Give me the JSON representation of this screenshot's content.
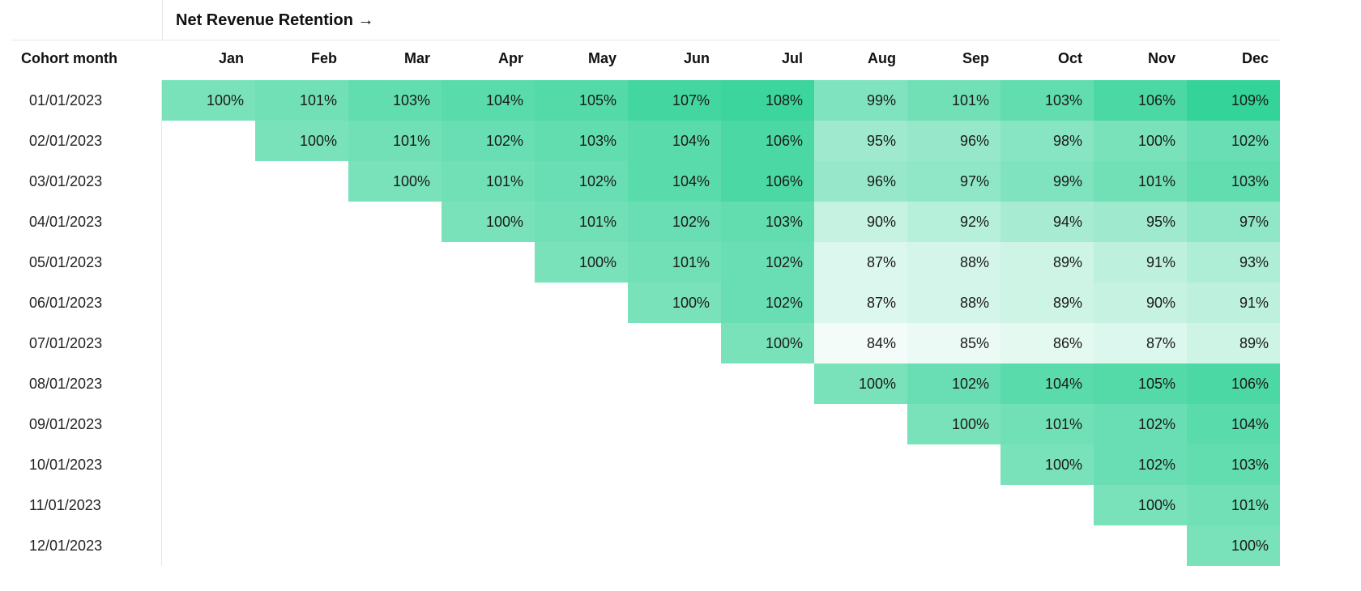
{
  "chart_data": {
    "type": "heatmap",
    "title": "Net Revenue Retention →",
    "row_header": "Cohort month",
    "columns": [
      "Jan",
      "Feb",
      "Mar",
      "Apr",
      "May",
      "Jun",
      "Jul",
      "Aug",
      "Sep",
      "Oct",
      "Nov",
      "Dec"
    ],
    "unit": "%",
    "color_scale": {
      "type": "linear",
      "domain_min": 84,
      "domain_max": 109,
      "range_min": "#f3fcf8",
      "range_max": "#34d399"
    },
    "rows": [
      {
        "label": "01/01/2023",
        "values": [
          100,
          101,
          103,
          104,
          105,
          107,
          108,
          99,
          101,
          103,
          106,
          109
        ]
      },
      {
        "label": "02/01/2023",
        "values": [
          null,
          100,
          101,
          102,
          103,
          104,
          106,
          95,
          96,
          98,
          100,
          102
        ]
      },
      {
        "label": "03/01/2023",
        "values": [
          null,
          null,
          100,
          101,
          102,
          104,
          106,
          96,
          97,
          99,
          101,
          103
        ]
      },
      {
        "label": "04/01/2023",
        "values": [
          null,
          null,
          null,
          100,
          101,
          102,
          103,
          90,
          92,
          94,
          95,
          97
        ]
      },
      {
        "label": "05/01/2023",
        "values": [
          null,
          null,
          null,
          null,
          100,
          101,
          102,
          87,
          88,
          89,
          91,
          93
        ]
      },
      {
        "label": "06/01/2023",
        "values": [
          null,
          null,
          null,
          null,
          null,
          100,
          102,
          87,
          88,
          89,
          90,
          91
        ]
      },
      {
        "label": "07/01/2023",
        "values": [
          null,
          null,
          null,
          null,
          null,
          null,
          100,
          84,
          85,
          86,
          87,
          89
        ]
      },
      {
        "label": "08/01/2023",
        "values": [
          null,
          null,
          null,
          null,
          null,
          null,
          null,
          100,
          102,
          104,
          105,
          106
        ]
      },
      {
        "label": "09/01/2023",
        "values": [
          null,
          null,
          null,
          null,
          null,
          null,
          null,
          null,
          100,
          101,
          102,
          104
        ]
      },
      {
        "label": "10/01/2023",
        "values": [
          null,
          null,
          null,
          null,
          null,
          null,
          null,
          null,
          null,
          100,
          102,
          103
        ]
      },
      {
        "label": "11/01/2023",
        "values": [
          null,
          null,
          null,
          null,
          null,
          null,
          null,
          null,
          null,
          null,
          100,
          101
        ]
      },
      {
        "label": "12/01/2023",
        "values": [
          null,
          null,
          null,
          null,
          null,
          null,
          null,
          null,
          null,
          null,
          null,
          100
        ]
      }
    ]
  }
}
